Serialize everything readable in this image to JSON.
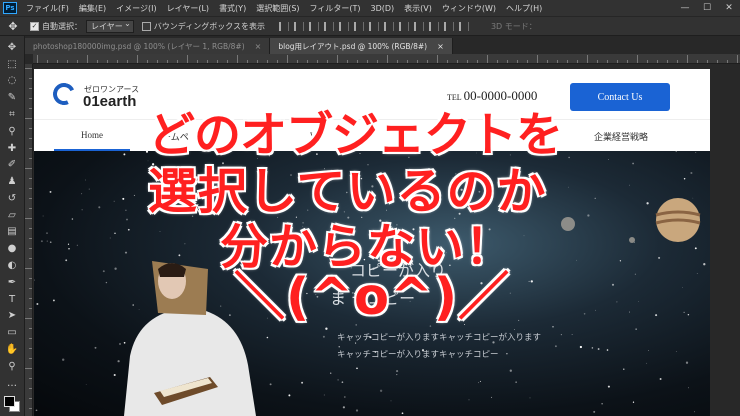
{
  "menubar": {
    "logo": "Ps",
    "items": [
      "ファイル(F)",
      "編集(E)",
      "イメージ(I)",
      "レイヤー(L)",
      "書式(Y)",
      "選択範囲(S)",
      "フィルター(T)",
      "3D(D)",
      "表示(V)",
      "ウィンドウ(W)",
      "ヘルプ(H)"
    ]
  },
  "optionsbar": {
    "auto_select_label": "自動選択：",
    "auto_select_value": "レイヤー",
    "bounding_box_label": "バウンディングボックスを表示",
    "three_d_mode": "3D モード："
  },
  "tabs": [
    {
      "label": "photoshop180000img.psd @ 100% (レイヤー 1, RGB/8#)",
      "close": "×"
    },
    {
      "label": "blog用レイアウト.psd @ 100% (RGB/8#)",
      "close": "×"
    }
  ],
  "site": {
    "logo_kana": "ゼロワンアース",
    "logo_name": "01earth",
    "tel_prefix": "TEL",
    "tel_number": "00-0000-0000",
    "contact_button": "Contact Us",
    "nav": {
      "home": "Home",
      "item2": "ームペ",
      "item3": "W",
      "item4": "企業経営戦略"
    },
    "hero": {
      "copy_line1": "コピーが入り",
      "copy_line2": "ま       チコピー",
      "sub_line1": "キャッチコピーが入りますキャッチコピーが入ります",
      "sub_line2": "キャッチコピーが入りますキャッチコピー"
    }
  },
  "caption": {
    "line1": "どのオブジェクトを",
    "line2": "選択しているのか",
    "line3": "分からない！",
    "line4": "＼(^o^)／"
  },
  "colors": {
    "accent": "#1a63d4",
    "caption_red": "#ff2020",
    "ui_dark": "#323232"
  }
}
